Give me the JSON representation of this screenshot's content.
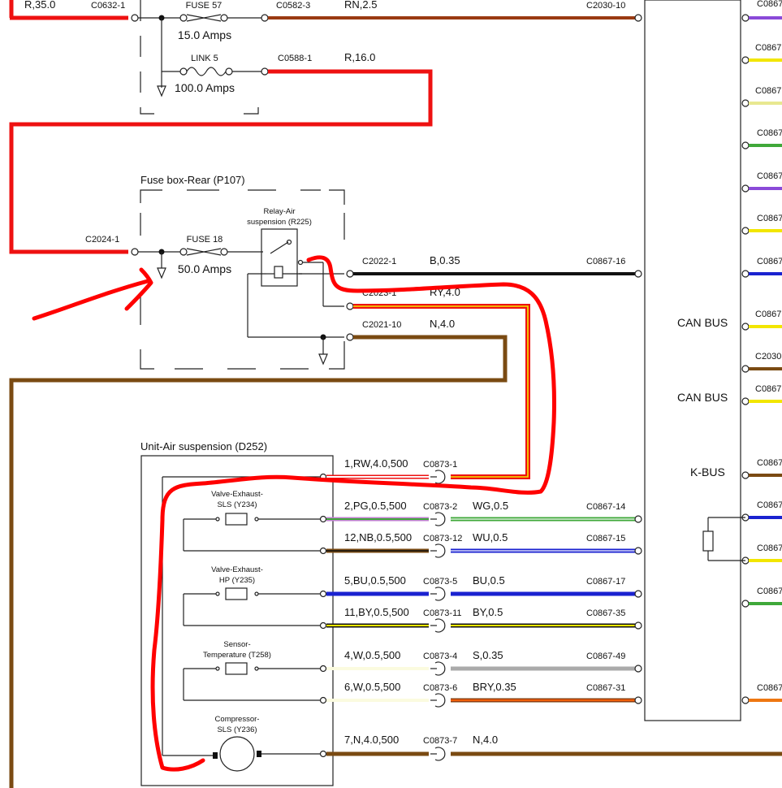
{
  "top": {
    "left_wire": "R,35.0",
    "c_left": "C0632-1",
    "fuse57_title": "FUSE 57",
    "fuse57_rating": "15.0 Amps",
    "c_top_mid": "C0582-3",
    "w_top": "RN,2.5",
    "c_top_right": "C2030-10",
    "link5_title": "LINK 5",
    "link5_rating": "100.0 Amps",
    "c_link": "C0588-1",
    "w_link": "R,16.0"
  },
  "rear_fusebox": {
    "title": "Fuse box-Rear (P107)",
    "c_in": "C2024-1",
    "fuse18_title": "FUSE 18",
    "fuse18_rating": "50.0 Amps",
    "relay_line1": "Relay-Air",
    "relay_line2": "suspension (R225)",
    "out1_conn": "C2022-1",
    "out1_wire": "B,0.35",
    "out1_dest": "C0867-16",
    "out2_conn": "C2023-1",
    "out2_wire": "RY,4.0",
    "out3_conn": "C2021-10",
    "out3_wire": "N,4.0"
  },
  "unit": {
    "title": "Unit-Air suspension (D252)",
    "valve_sls_l1": "Valve-Exhaust-",
    "valve_sls_l2": "SLS (Y234)",
    "valve_hp_l1": "Valve-Exhaust-",
    "valve_hp_l2": "HP (Y235)",
    "sensor_l1": "Sensor-",
    "sensor_l2": "Temperature (T258)",
    "comp_l1": "Compressor-",
    "comp_l2": "SLS (Y236)"
  },
  "pins": [
    {
      "pin": "1,RW,4.0,500",
      "conn": "C0873-1",
      "wire": "",
      "dest": ""
    },
    {
      "pin": "2,PG,0.5,500",
      "conn": "C0873-2",
      "wire": "WG,0.5",
      "dest": "C0867-14"
    },
    {
      "pin": "12,NB,0.5,500",
      "conn": "C0873-12",
      "wire": "WU,0.5",
      "dest": "C0867-15"
    },
    {
      "pin": "5,BU,0.5,500",
      "conn": "C0873-5",
      "wire": "BU,0.5",
      "dest": "C0867-17"
    },
    {
      "pin": "11,BY,0.5,500",
      "conn": "C0873-11",
      "wire": "BY,0.5",
      "dest": "C0867-35"
    },
    {
      "pin": "4,W,0.5,500",
      "conn": "C0873-4",
      "wire": "S,0.35",
      "dest": "C0867-49"
    },
    {
      "pin": "6,W,0.5,500",
      "conn": "C0873-6",
      "wire": "BRY,0.35",
      "dest": "C0867-31"
    },
    {
      "pin": "7,N,4.0,500",
      "conn": "C0873-7",
      "wire": "N,4.0",
      "dest": ""
    }
  ],
  "right_module": {
    "bus_labels": [
      "CAN BUS",
      "CAN BUS",
      "K-BUS"
    ],
    "conn_stub": "C0867",
    "conn_stub_2030": "C2030"
  },
  "colors": {
    "red": "#ee1111",
    "brown": "#7a4a12",
    "black": "#111111",
    "yellow": "#f2e600",
    "green": "#3fa83a",
    "blue": "#1a22d0",
    "purple": "#8a4ad8",
    "gray": "#aaaaaa",
    "annotation": "#ff0000"
  }
}
